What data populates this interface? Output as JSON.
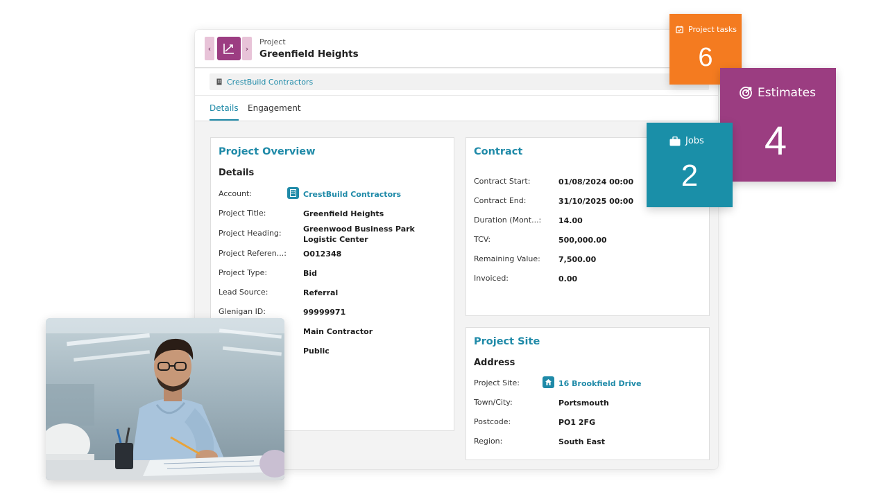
{
  "header": {
    "kicker": "Project",
    "title": "Greenfield Heights",
    "nav_prev": "‹",
    "nav_next": "›"
  },
  "account_bar": {
    "label": "CrestBuild Contractors"
  },
  "tabs": [
    {
      "label": "Details",
      "active": true
    },
    {
      "label": "Engagement",
      "active": false
    }
  ],
  "overview": {
    "title": "Project Overview",
    "subtitle": "Details",
    "rows": [
      {
        "label": "Account:",
        "value": "CrestBuild Contractors"
      },
      {
        "label": "Project Title:",
        "value": "Greenfield Heights"
      },
      {
        "label": "Project Heading:",
        "value": "Greenwood Business Park Logistic Center"
      },
      {
        "label": "Project Referen...:",
        "value": "O012348"
      },
      {
        "label": "Project Type:",
        "value": "Bid"
      },
      {
        "label": "Lead Source:",
        "value": "Referral"
      },
      {
        "label": "Glenigan ID:",
        "value": "99999971"
      },
      {
        "label": "",
        "value": "Main Contractor"
      },
      {
        "label": "",
        "value": "Public"
      }
    ]
  },
  "contract": {
    "title": "Contract",
    "rows": [
      {
        "label": "Contract Start:",
        "value": "01/08/2024 00:00"
      },
      {
        "label": "Contract End:",
        "value": "31/10/2025 00:00"
      },
      {
        "label": "Duration (Mont...:",
        "value": "14.00"
      },
      {
        "label": "TCV:",
        "value": "500,000.00"
      },
      {
        "label": "Remaining Value:",
        "value": "7,500.00"
      },
      {
        "label": "Invoiced:",
        "value": "0.00"
      }
    ]
  },
  "site": {
    "title": "Project Site",
    "subtitle": "Address",
    "rows": [
      {
        "label": "Project Site:",
        "value": "16 Brookfield Drive"
      },
      {
        "label": "Town/City:",
        "value": "Portsmouth"
      },
      {
        "label": "Postcode:",
        "value": "PO1 2FG"
      },
      {
        "label": "Region:",
        "value": "South East"
      }
    ]
  },
  "tiles": {
    "tasks": {
      "label": "Project tasks",
      "count": "6",
      "color": "#f47b20",
      "icon": "calendar-check-icon"
    },
    "estimates": {
      "label": "Estimates",
      "count": "4",
      "color": "#9b3d81",
      "icon": "target-icon"
    },
    "jobs": {
      "label": "Jobs",
      "count": "2",
      "color": "#1a8fa8",
      "icon": "briefcase-icon"
    }
  },
  "colors": {
    "accent": "#1f8aa8",
    "entity": "#9c3d82"
  }
}
